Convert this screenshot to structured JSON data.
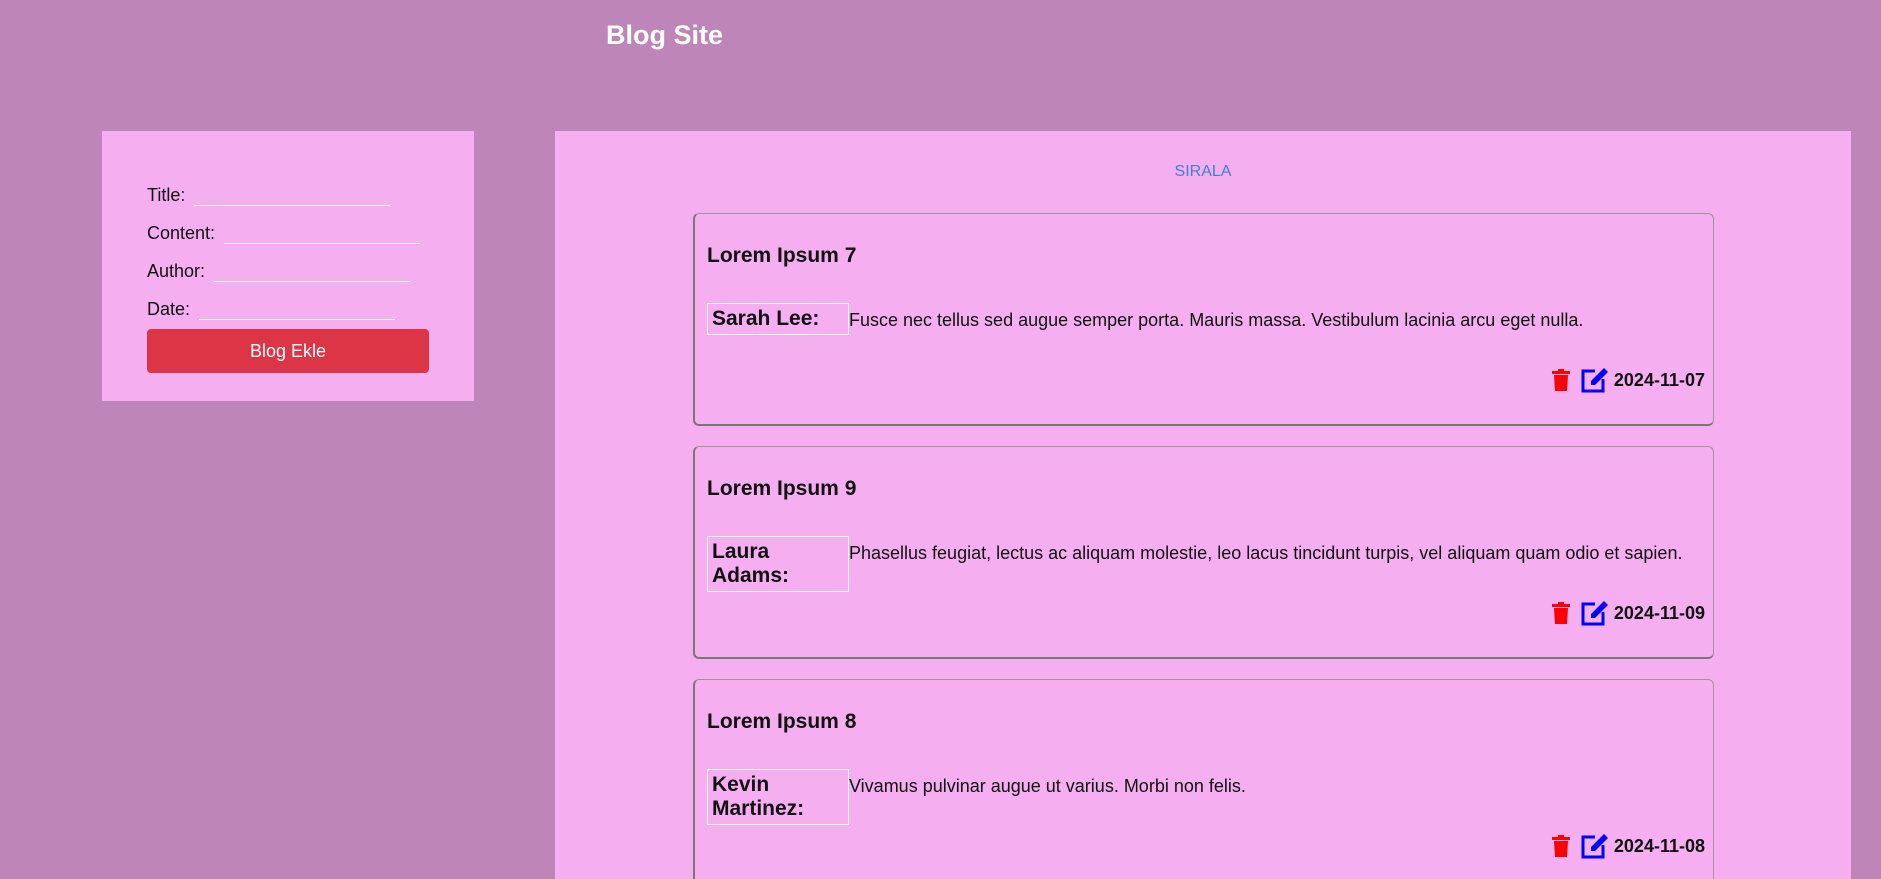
{
  "header": {
    "title": "Blog Site"
  },
  "form": {
    "title_label": "Title:",
    "content_label": "Content:",
    "author_label": "Author:",
    "date_label": "Date:",
    "title_value": "",
    "content_value": "",
    "author_value": "",
    "date_value": "",
    "submit_label": "Blog Ekle"
  },
  "sort": {
    "label": "SIRALA"
  },
  "posts": [
    {
      "title": "Lorem Ipsum 7",
      "author": "Sarah Lee:",
      "content": "Fusce nec tellus sed augue semper porta. Mauris massa. Vestibulum lacinia arcu eget nulla.",
      "date": "2024-11-07"
    },
    {
      "title": "Lorem Ipsum 9",
      "author": "Laura Adams:",
      "content": "Phasellus feugiat, lectus ac aliquam molestie, leo lacus tincidunt turpis, vel aliquam quam odio et sapien.",
      "date": "2024-11-09"
    },
    {
      "title": "Lorem Ipsum 8",
      "author": "Kevin Martinez:",
      "content": "Vivamus pulvinar augue ut varius. Morbi non felis.",
      "date": "2024-11-08"
    }
  ],
  "icons": {
    "delete": "trash-icon",
    "edit": "edit-icon"
  },
  "colors": {
    "page_bg": "#be86b8",
    "panel_bg": "#f5aff0",
    "submit_button": "#dc3545",
    "sort_link": "#3f7fd6",
    "delete_icon": "#ff0000",
    "edit_icon": "#0000ff"
  }
}
